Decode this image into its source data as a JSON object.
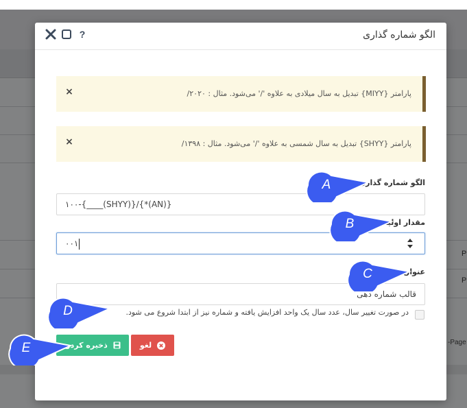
{
  "background": {
    "row_p_1": "P",
    "row_p_2": "P",
    "page_text": "-Page"
  },
  "dialog": {
    "title": "الگو شماره گذاری",
    "header_icons": [
      "help-icon",
      "maximize-icon",
      "close-icon"
    ],
    "help_symbol": "?",
    "alerts": [
      {
        "text": "پارامتر {MIYY} تبدیل به سال میلادی به علاوه '/' می‌شود. مثال : ۲۰۲۰/"
      },
      {
        "text": "پارامتر {SHYY} تبدیل به سال شمسی به علاوه '/' می‌شود. مثال : ۱۳۹۸/"
      }
    ],
    "alert_close_symbol": "×",
    "fields": {
      "pattern": {
        "label": "الگو شماره گذاری:",
        "value": "۱۰۰-{____(SHYY)}/{*(AN)}"
      },
      "initial": {
        "label": "مقدار اولیه:",
        "value": "۰۰۱"
      },
      "title": {
        "label": "عنوان:",
        "value": "قالب شماره دهی"
      }
    },
    "checkbox": {
      "label": "در صورت تغییر سال، عدد سال یک واحد افزایش یافته و شماره نیز از ابتدا شروع می شود.",
      "checked": false
    },
    "buttons": {
      "cancel": "لغو",
      "save": "ذخیره کردن"
    }
  },
  "callouts": [
    "A",
    "B",
    "C",
    "D",
    "E"
  ],
  "colors": {
    "save_button": "#3bbf8a",
    "cancel_button": "#e0524c",
    "alert_bg": "#fcf8e3",
    "alert_border": "#7a5f30",
    "callout": "#3b5cf0"
  }
}
